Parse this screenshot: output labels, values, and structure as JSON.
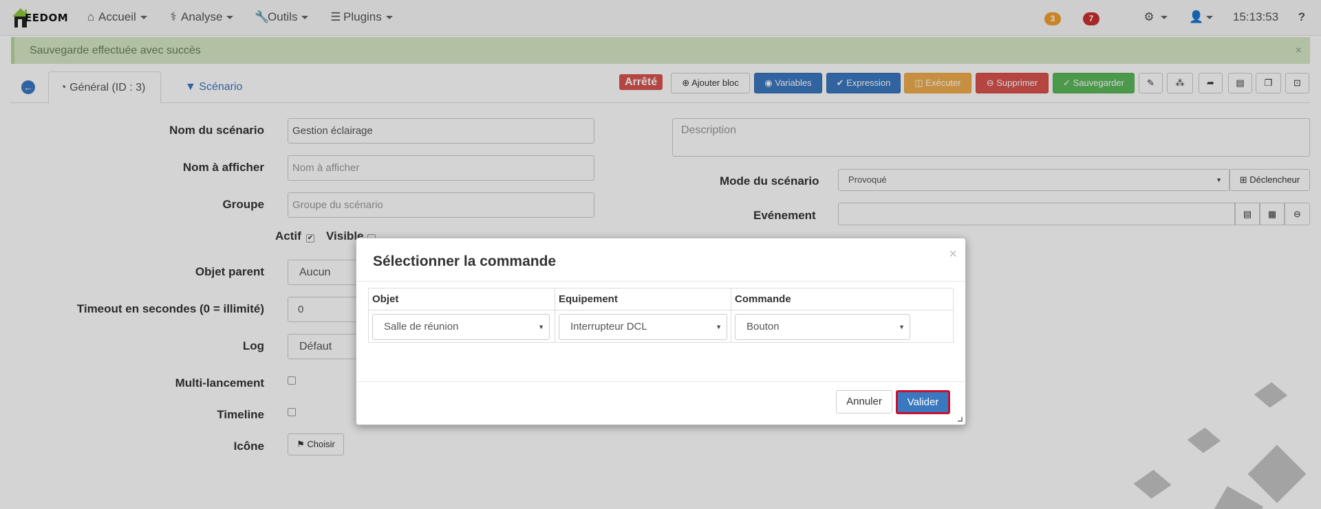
{
  "navbar": {
    "logo_text": "EEDOM",
    "menu": [
      {
        "label": "Accueil",
        "icon": "home-icon"
      },
      {
        "label": "Analyse",
        "icon": "stethoscope-icon"
      },
      {
        "label": "Outils",
        "icon": "wrench-icon"
      },
      {
        "label": "Plugins",
        "icon": "tasks-icon"
      }
    ],
    "badge_orange": "3",
    "badge_red": "7",
    "clock": "15:13:53",
    "help_glyph": "?"
  },
  "alert": {
    "message": "Sauvegarde effectuée avec succès",
    "close": "×"
  },
  "tabs": {
    "general": "Général (ID : 3)",
    "scenario": "Scénario"
  },
  "toolbar": {
    "status": "Arrêté",
    "add_block": "Ajouter bloc",
    "variables": "Variables",
    "expression": "Expression",
    "execute": "Exécuter",
    "delete": "Supprimer",
    "save": "Sauvegarder"
  },
  "form": {
    "name_label": "Nom du scénario",
    "name_value": "Gestion éclairage",
    "display_label": "Nom à afficher",
    "display_placeholder": "Nom à afficher",
    "group_label": "Groupe",
    "group_placeholder": "Groupe du scénario",
    "actif_label": "Actif",
    "visible_label": "Visible",
    "parent_label": "Objet parent",
    "parent_value": "Aucun",
    "timeout_label": "Timeout en secondes (0 = illimité)",
    "timeout_value": "0",
    "log_label": "Log",
    "log_value": "Défaut",
    "multi_label": "Multi-lancement",
    "timeline_label": "Timeline",
    "icon_label": "Icône",
    "icon_button": "Choisir"
  },
  "right_form": {
    "description_placeholder": "Description",
    "mode_label": "Mode du scénario",
    "mode_value": "Provoqué",
    "trigger_button": "Déclencheur",
    "event_label": "Evénement"
  },
  "modal": {
    "title": "Sélectionner la commande",
    "close": "×",
    "columns": [
      "Objet",
      "Equipement",
      "Commande"
    ],
    "values": [
      "Salle de réunion",
      "Interrupteur DCL",
      "Bouton"
    ],
    "cancel": "Annuler",
    "validate": "Valider"
  }
}
